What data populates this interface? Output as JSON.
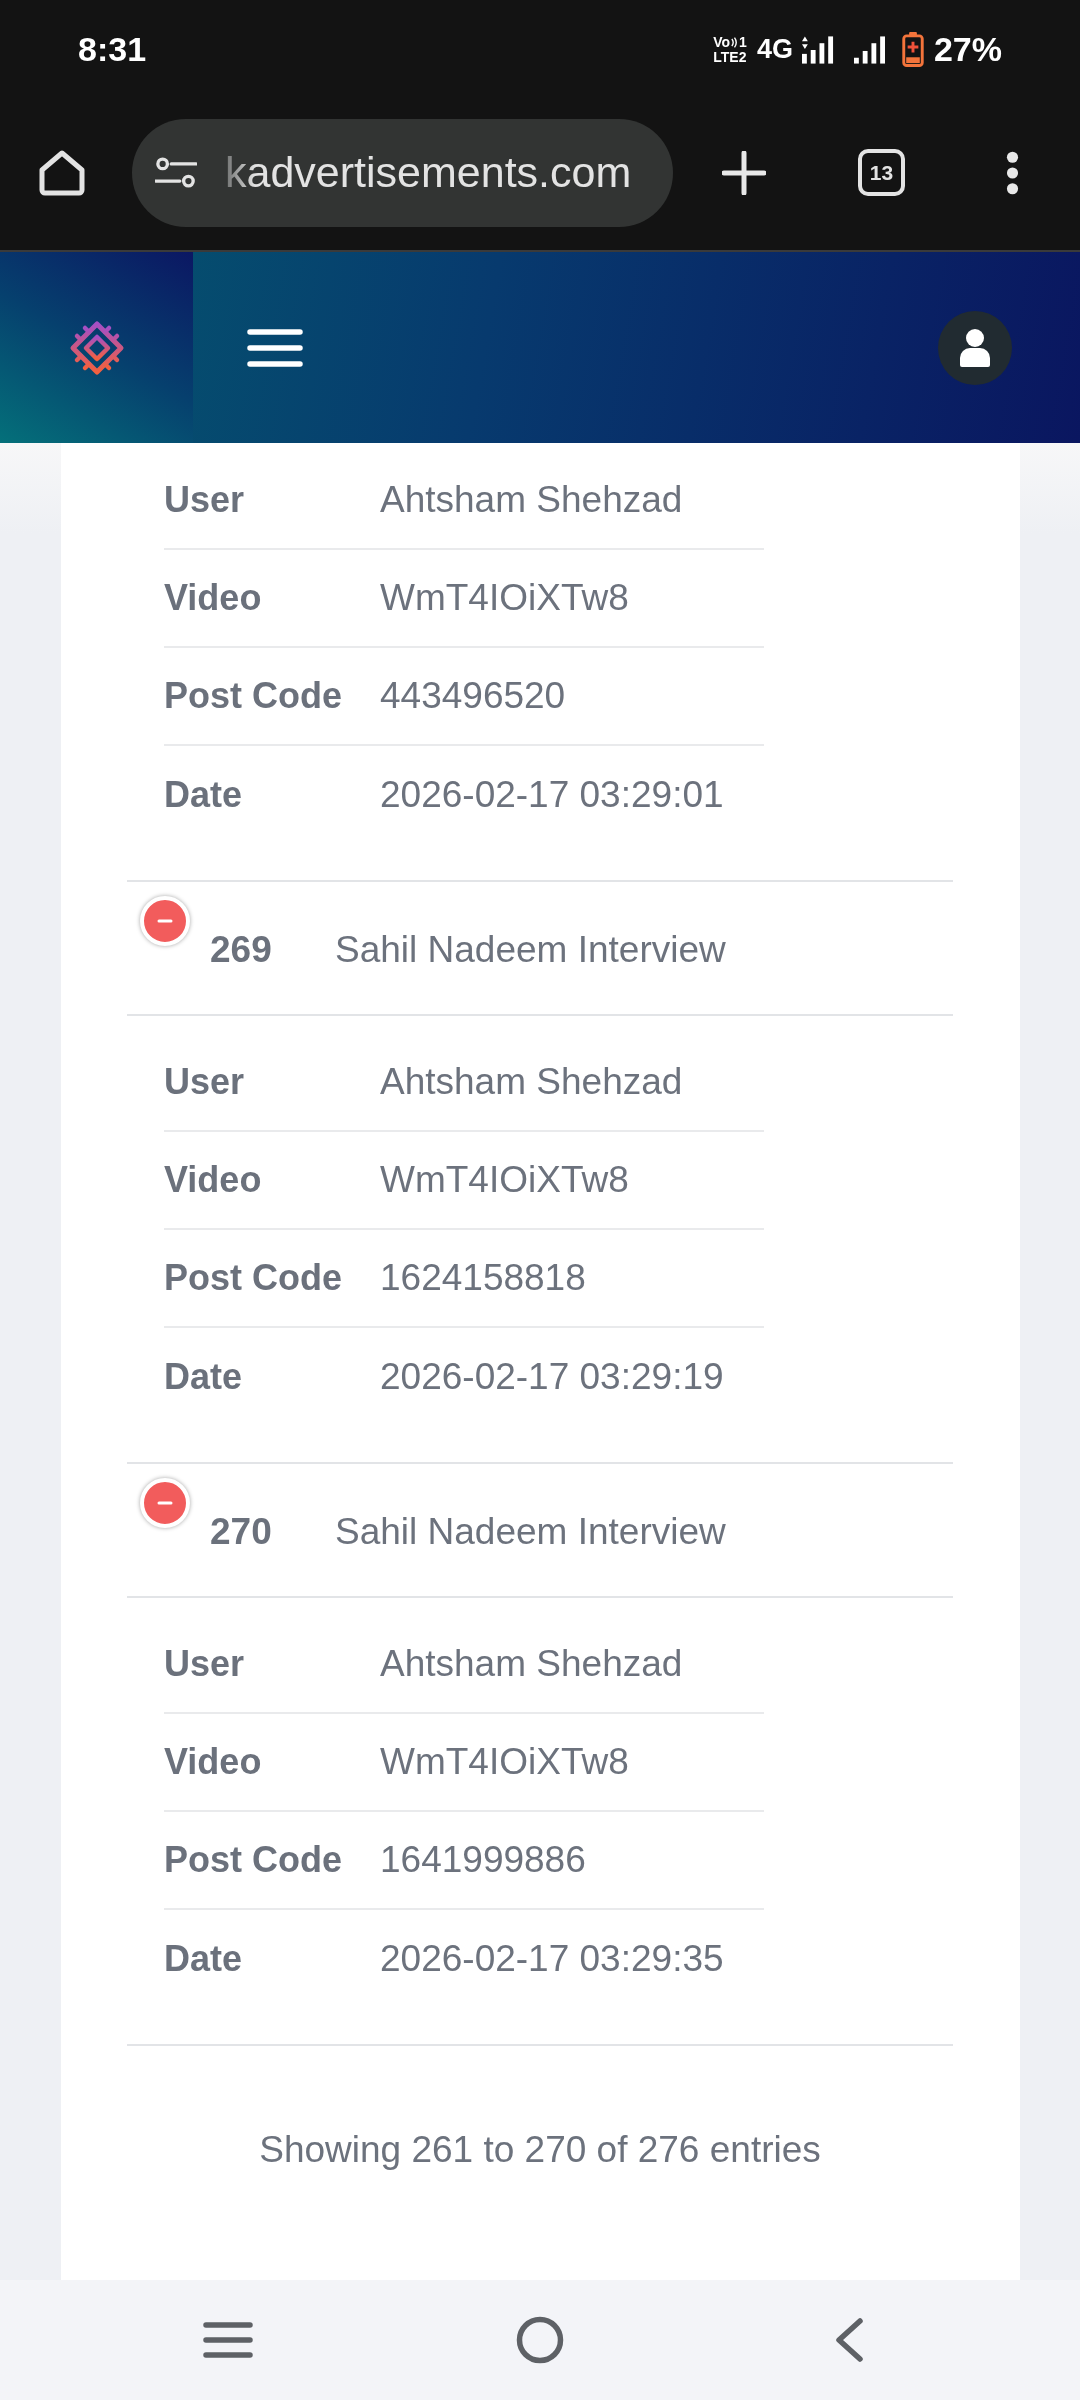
{
  "status_bar": {
    "time": "8:31",
    "volte_top": "Vo",
    "volte_sim": "1",
    "volte_bottom": "LTE2",
    "network": "4G",
    "battery": "27%"
  },
  "browser": {
    "url": "kadvertisements.com",
    "tab_count": "13"
  },
  "table": {
    "partial_row_details": [
      {
        "label": "User",
        "value": "Ahtsham Shehzad"
      },
      {
        "label": "Video",
        "value": "WmT4IOiXTw8"
      },
      {
        "label": "Post Code",
        "value": "443496520"
      },
      {
        "label": "Date",
        "value": "2026-02-17 03:29:01"
      }
    ],
    "rows": [
      {
        "id": "269",
        "title": "Sahil Nadeem Interview",
        "expanded": true,
        "details": [
          {
            "label": "User",
            "value": "Ahtsham Shehzad"
          },
          {
            "label": "Video",
            "value": "WmT4IOiXTw8"
          },
          {
            "label": "Post Code",
            "value": "1624158818"
          },
          {
            "label": "Date",
            "value": "2026-02-17 03:29:19"
          }
        ]
      },
      {
        "id": "270",
        "title": "Sahil Nadeem Interview",
        "expanded": true,
        "details": [
          {
            "label": "User",
            "value": "Ahtsham Shehzad"
          },
          {
            "label": "Video",
            "value": "WmT4IOiXTw8"
          },
          {
            "label": "Post Code",
            "value": "1641999886"
          },
          {
            "label": "Date",
            "value": "2026-02-17 03:29:35"
          }
        ]
      }
    ],
    "info": "Showing 261 to 270 of 276 entries"
  }
}
